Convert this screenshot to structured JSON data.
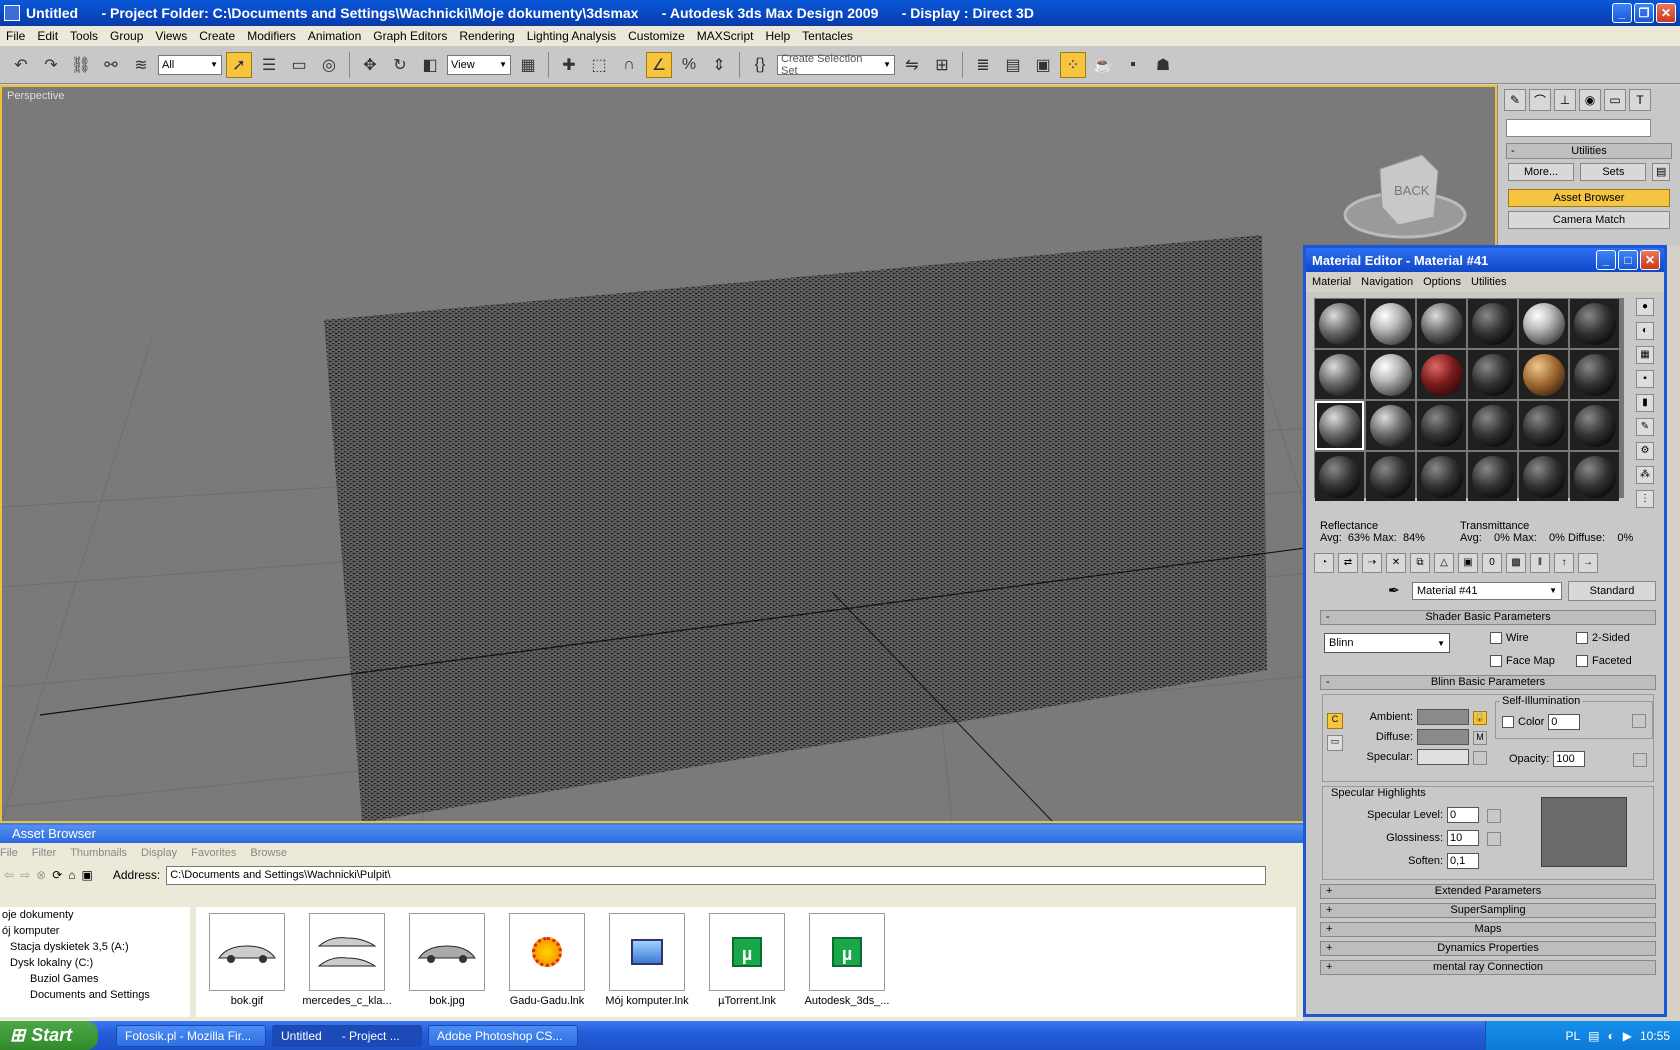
{
  "window": {
    "title": "Untitled      - Project Folder: C:\\Documents and Settings\\Wachnicki\\Moje dokumenty\\3dsmax      - Autodesk 3ds Max Design 2009      - Display : Direct 3D"
  },
  "menu": [
    "File",
    "Edit",
    "Tools",
    "Group",
    "Views",
    "Create",
    "Modifiers",
    "Animation",
    "Graph Editors",
    "Rendering",
    "Lighting Analysis",
    "Customize",
    "MAXScript",
    "Help",
    "Tentacles"
  ],
  "toolbar": {
    "filter_select": "All",
    "coord_select": "View",
    "selection_set": "Create Selection Set"
  },
  "viewport": {
    "label": "Perspective",
    "viewcube_label": "BACK"
  },
  "command_panel": {
    "rollout_title": "Utilities",
    "more_label": "More...",
    "sets_label": "Sets",
    "asset_browser_label": "Asset Browser",
    "camera_match_label": "Camera Match"
  },
  "material_editor": {
    "title": "Material Editor - Material #41",
    "menu": [
      "Material",
      "Navigation",
      "Options",
      "Utilities"
    ],
    "reflectance_label": "Reflectance",
    "reflectance_values": "Avg:  63% Max:  84%",
    "transmittance_label": "Transmittance",
    "transmittance_values": "Avg:    0% Max:    0% Diffuse:    0%",
    "material_name": "Material #41",
    "material_type": "Standard",
    "shader_section": "Shader Basic Parameters",
    "shader_value": "Blinn",
    "wire_label": "Wire",
    "two_sided_label": "2-Sided",
    "face_map_label": "Face Map",
    "faceted_label": "Faceted",
    "blinn_section": "Blinn Basic Parameters",
    "self_illum_label": "Self-Illumination",
    "color_label": "Color",
    "color_value": "0",
    "ambient_label": "Ambient:",
    "diffuse_label": "Diffuse:",
    "specular_label": "Specular:",
    "m_label": "M",
    "opacity_label": "Opacity:",
    "opacity_value": "100",
    "spec_highlights_label": "Specular Highlights",
    "spec_level_label": "Specular Level:",
    "spec_level_value": "0",
    "glossiness_label": "Glossiness:",
    "glossiness_value": "10",
    "soften_label": "Soften:",
    "soften_value": "0,1",
    "sections": [
      "Extended Parameters",
      "SuperSampling",
      "Maps",
      "Dynamics Properties",
      "mental ray Connection"
    ]
  },
  "asset_browser": {
    "title": "Asset Browser",
    "menu": [
      "File",
      "Filter",
      "Thumbnails",
      "Display",
      "Favorites",
      "Browse"
    ],
    "address_label": "Address:",
    "address_value": "C:\\Documents and Settings\\Wachnicki\\Pulpit\\",
    "tree": [
      "oje dokumenty",
      "ój komputer",
      "Stacja dyskietek 3,5 (A:)",
      "Dysk lokalny (C:)",
      "Buziol Games",
      "Documents and Settings"
    ],
    "files": [
      "bok.gif",
      "mercedes_c_kla...",
      "bok.jpg",
      "Gadu-Gadu.lnk",
      "Mój komputer.lnk",
      "µTorrent.lnk",
      "Autodesk_3ds_..."
    ]
  },
  "taskbar": {
    "start": "Start",
    "tasks": [
      "Fotosik.pl - Mozilla Fir...",
      "Untitled      - Project ...",
      "Adobe Photoshop CS..."
    ],
    "lang": "PL",
    "clock": "10:55"
  }
}
